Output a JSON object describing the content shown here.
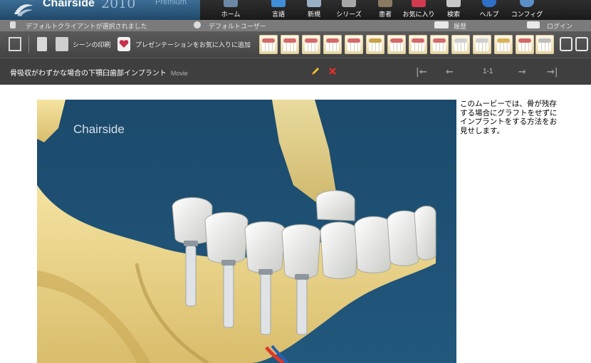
{
  "app": {
    "name": "Chairside",
    "year": "2010",
    "edition": "Premium",
    "watermark": "Chairside"
  },
  "menu": [
    {
      "id": "home",
      "label": "ホーム",
      "icon": "home-icon"
    },
    {
      "id": "glossary",
      "label": "言語",
      "icon": "glossary-icon"
    },
    {
      "id": "new",
      "label": "新規",
      "icon": "new-icon"
    },
    {
      "id": "series",
      "label": "シリーズ",
      "icon": "series-icon"
    },
    {
      "id": "patient",
      "label": "患者",
      "icon": "patient-icon"
    },
    {
      "id": "favorites",
      "label": "お気に入り",
      "icon": "favorites-icon"
    },
    {
      "id": "search",
      "label": "検索",
      "icon": "search-icon"
    },
    {
      "id": "help",
      "label": "ヘルプ",
      "icon": "help-icon"
    },
    {
      "id": "config",
      "label": "コンフィグ",
      "icon": "config-icon"
    }
  ],
  "status": {
    "client": "デフォルトクライアントが選択されました",
    "user": "デフォルトユーザー",
    "history": "履歴",
    "login": "ログイン"
  },
  "toolbar": {
    "print_scene": "シーンの印刷",
    "add_favorite": "プレゼンテーションをお気に入りに追加"
  },
  "title": {
    "text": "骨吸収がわずかな場合の下顎臼歯部インプラント",
    "tag": "Movie",
    "page": "1-1"
  },
  "description": "このムービーでは、骨が残存する場合にグラフトをせずにインプラントをする方法をお見せします。",
  "colors": {
    "accent_blue": "#2b5a82",
    "toolbar_gray": "#4f4f4f",
    "titlebar_gray": "#3f3f3f",
    "video_bg": "#1e4f72"
  }
}
